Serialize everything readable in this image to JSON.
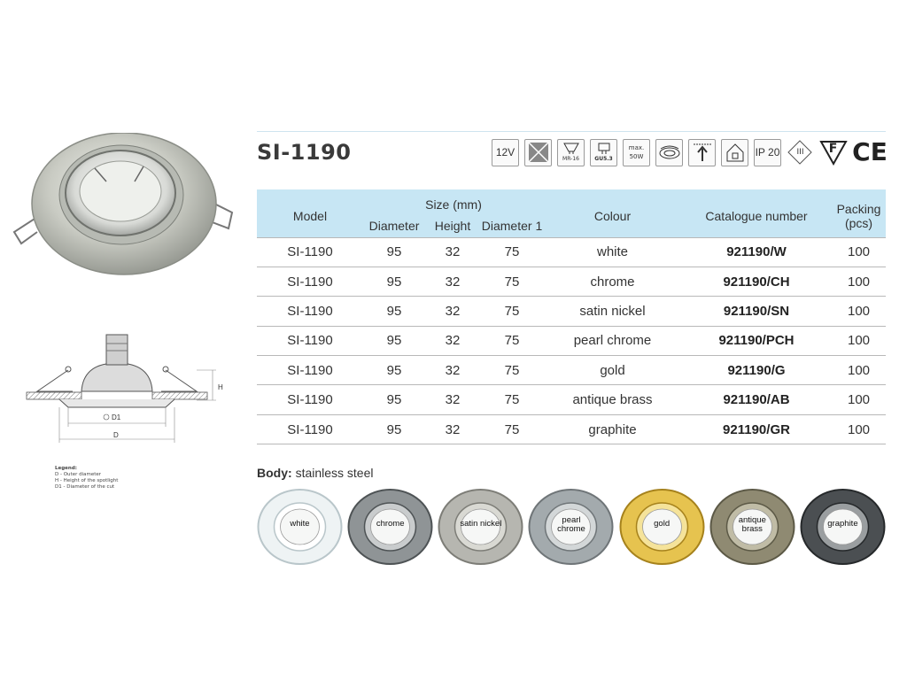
{
  "product": {
    "model": "SI-1190",
    "body_label": "Body:",
    "body_material": "stainless steel"
  },
  "spec_icons": [
    {
      "name": "voltage",
      "text": "12V"
    },
    {
      "name": "no-cover",
      "text": ""
    },
    {
      "name": "bulb-type",
      "text": "MR-16"
    },
    {
      "name": "socket-type",
      "text": "GU5.3"
    },
    {
      "name": "max-power",
      "text": "max. 50W"
    },
    {
      "name": "spring-mount",
      "text": ""
    },
    {
      "name": "ceiling-mount",
      "text": ""
    },
    {
      "name": "indoor",
      "text": ""
    },
    {
      "name": "ip-rating",
      "text": "IP 20"
    },
    {
      "name": "class-iii",
      "text": "III"
    },
    {
      "name": "f-mark",
      "text": "F"
    },
    {
      "name": "ce-mark",
      "text": "CE"
    }
  ],
  "table": {
    "headers": {
      "model": "Model",
      "size": "Size (mm)",
      "diameter": "Diameter",
      "height": "Height",
      "diameter1": "Diameter 1",
      "colour": "Colour",
      "catalogue": "Catalogue number",
      "packing": "Packing",
      "packing_unit": "(pcs)"
    },
    "rows": [
      {
        "model": "SI-1190",
        "diameter": "95",
        "height": "32",
        "diameter1": "75",
        "colour": "white",
        "catalogue": "921190/W",
        "packing": "100"
      },
      {
        "model": "SI-1190",
        "diameter": "95",
        "height": "32",
        "diameter1": "75",
        "colour": "chrome",
        "catalogue": "921190/CH",
        "packing": "100"
      },
      {
        "model": "SI-1190",
        "diameter": "95",
        "height": "32",
        "diameter1": "75",
        "colour": "satin nickel",
        "catalogue": "921190/SN",
        "packing": "100"
      },
      {
        "model": "SI-1190",
        "diameter": "95",
        "height": "32",
        "diameter1": "75",
        "colour": "pearl chrome",
        "catalogue": "921190/PCH",
        "packing": "100"
      },
      {
        "model": "SI-1190",
        "diameter": "95",
        "height": "32",
        "diameter1": "75",
        "colour": "gold",
        "catalogue": "921190/G",
        "packing": "100"
      },
      {
        "model": "SI-1190",
        "diameter": "95",
        "height": "32",
        "diameter1": "75",
        "colour": "antique brass",
        "catalogue": "921190/AB",
        "packing": "100"
      },
      {
        "model": "SI-1190",
        "diameter": "95",
        "height": "32",
        "diameter1": "75",
        "colour": "graphite",
        "catalogue": "921190/GR",
        "packing": "100"
      }
    ]
  },
  "drawing": {
    "label_h": "H",
    "label_d1": "D1",
    "label_d": "D"
  },
  "legend": {
    "title": "Legend:",
    "items": [
      "D - Outer diameter",
      "H - Height of the spotlight",
      "D1 - Diameter of the cut"
    ]
  },
  "swatches": [
    {
      "line1": "white",
      "line2": "",
      "ring": "#eef3f4",
      "ring_edge": "#b9c6ca",
      "inner": "#ffffff"
    },
    {
      "line1": "chrome",
      "line2": "",
      "ring": "#8f9496",
      "ring_edge": "#4e5355",
      "inner": "#c9cccd"
    },
    {
      "line1": "satin nickel",
      "line2": "",
      "ring": "#b6b6b0",
      "ring_edge": "#7d7d77",
      "inner": "#d9d9d3"
    },
    {
      "line1": "pearl",
      "line2": "chrome",
      "ring": "#a3aaad",
      "ring_edge": "#6f7578",
      "inner": "#d3d7d8"
    },
    {
      "line1": "gold",
      "line2": "",
      "ring": "#e6c34f",
      "ring_edge": "#a6821c",
      "inner": "#f5e39a"
    },
    {
      "line1": "antique",
      "line2": "brass",
      "ring": "#8f8a72",
      "ring_edge": "#5c5946",
      "inner": "#c0bca6"
    },
    {
      "line1": "graphite",
      "line2": "",
      "ring": "#4b4f52",
      "ring_edge": "#26292b",
      "inner": "#9a9ea0"
    }
  ]
}
